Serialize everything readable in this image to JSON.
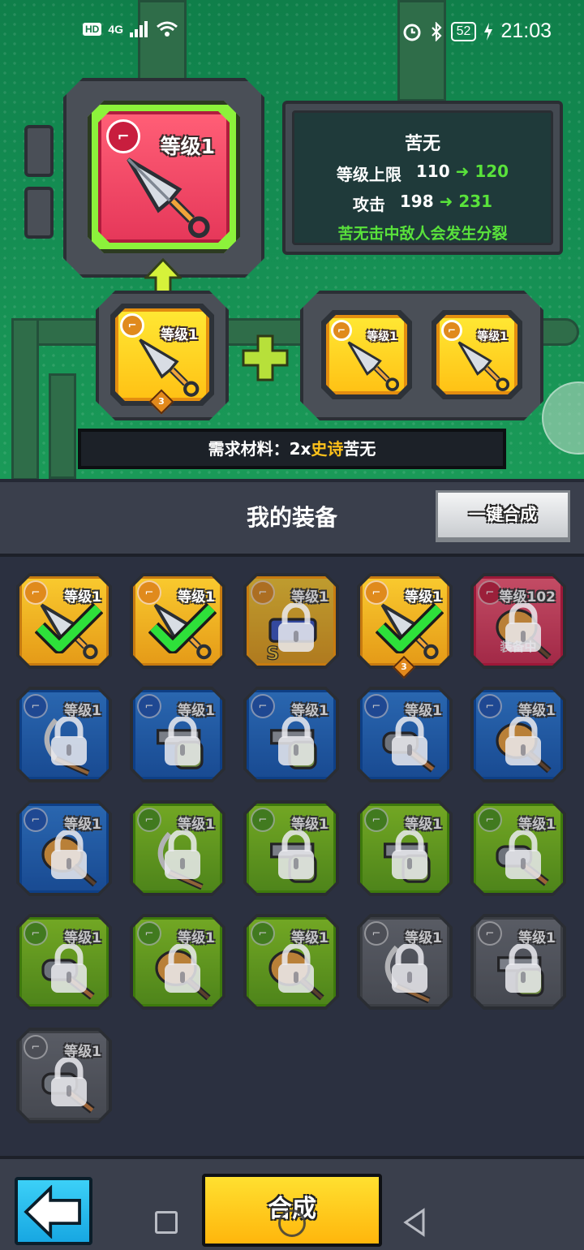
{
  "status_bar": {
    "hd": "HD",
    "network": "4G",
    "battery": "52",
    "time": "21:03"
  },
  "target": {
    "level_label": "等级1",
    "name": "苦无",
    "max_level_label": "等级上限",
    "max_level_from": "110",
    "max_level_to": "120",
    "attack_label": "攻击",
    "attack_from": "198",
    "attack_to": "231",
    "effect": "苦无击中敌人会发生分裂"
  },
  "materials": {
    "source_level": "等级1",
    "source_stars": "3",
    "slot1_level": "等级1",
    "slot2_level": "等级1",
    "requirement_prefix": "需求材料：2x",
    "requirement_rarity": "史诗",
    "requirement_item": "苦无"
  },
  "inventory": {
    "title": "我的装备",
    "merge_all_label": "一键合成",
    "items": [
      {
        "rarity": "yellow",
        "level": "等级1",
        "state": "selected",
        "weapon": "kunai"
      },
      {
        "rarity": "yellow",
        "level": "等级1",
        "state": "selected",
        "weapon": "kunai"
      },
      {
        "rarity": "yellow",
        "level": "等级1",
        "state": "locked",
        "weapon": "gun-s"
      },
      {
        "rarity": "yellow",
        "level": "等级1",
        "state": "selected",
        "weapon": "kunai",
        "stars": "3"
      },
      {
        "rarity": "red",
        "level": "等级102",
        "state": "locked",
        "weapon": "bat",
        "note": "装备中"
      },
      {
        "rarity": "blue",
        "level": "等级1",
        "state": "locked",
        "weapon": "sickle"
      },
      {
        "rarity": "blue",
        "level": "等级1",
        "state": "locked",
        "weapon": "shotgun"
      },
      {
        "rarity": "blue",
        "level": "等级1",
        "state": "locked",
        "weapon": "shotgun"
      },
      {
        "rarity": "blue",
        "level": "等级1",
        "state": "locked",
        "weapon": "cannon"
      },
      {
        "rarity": "blue",
        "level": "等级1",
        "state": "locked",
        "weapon": "bat"
      },
      {
        "rarity": "blue",
        "level": "等级1",
        "state": "locked",
        "weapon": "bat"
      },
      {
        "rarity": "green",
        "level": "等级1",
        "state": "locked",
        "weapon": "sickle"
      },
      {
        "rarity": "green",
        "level": "等级1",
        "state": "locked",
        "weapon": "shotgun"
      },
      {
        "rarity": "green",
        "level": "等级1",
        "state": "locked",
        "weapon": "shotgun"
      },
      {
        "rarity": "green",
        "level": "等级1",
        "state": "locked",
        "weapon": "cannon"
      },
      {
        "rarity": "green",
        "level": "等级1",
        "state": "locked",
        "weapon": "cannon"
      },
      {
        "rarity": "green",
        "level": "等级1",
        "state": "locked",
        "weapon": "bat"
      },
      {
        "rarity": "green",
        "level": "等级1",
        "state": "locked",
        "weapon": "bat"
      },
      {
        "rarity": "gray",
        "level": "等级1",
        "state": "locked",
        "weapon": "sickle"
      },
      {
        "rarity": "gray",
        "level": "等级1",
        "state": "locked",
        "weapon": "shotgun"
      },
      {
        "rarity": "gray",
        "level": "等级1",
        "state": "locked",
        "weapon": "cannon"
      }
    ]
  },
  "bottom": {
    "craft_label": "合成"
  },
  "colors": {
    "accent_green": "#59e23b",
    "epic_gold": "#ffc21a",
    "craft_yellow": "#ffc215",
    "back_blue": "#17a7e2"
  }
}
